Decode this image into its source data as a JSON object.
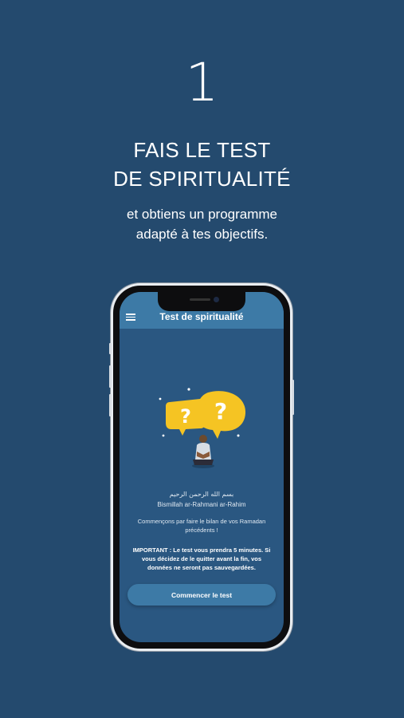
{
  "page": {
    "step_number": "1",
    "headline_line1": "FAIS LE TEST",
    "headline_line2": "DE SPIRITUALITÉ",
    "subline_line1": "et obtiens un programme",
    "subline_line2": "adapté à tes objectifs."
  },
  "app": {
    "title": "Test de spiritualité",
    "menu_icon": "hamburger-menu-icon",
    "illustration": "question-bubbles-reader-illustration",
    "bismillah_arabic": "بسم الله الرحمن الرحيم",
    "bismillah_translit": "Bismillah ar-Rahmani ar-Rahim",
    "intro_text": "Commençons par faire le bilan de vos Ramadan précédents !",
    "important_text": "IMPORTANT : Le test vous prendra 5 minutes. Si vous décidez de le quitter avant la fin, vos données ne seront pas sauvegardées.",
    "start_button": "Commencer le test"
  },
  "colors": {
    "background": "#244a6e",
    "app_bar": "#3d7aa6",
    "screen_bg": "#2a5781",
    "bubble": "#f5c423"
  }
}
